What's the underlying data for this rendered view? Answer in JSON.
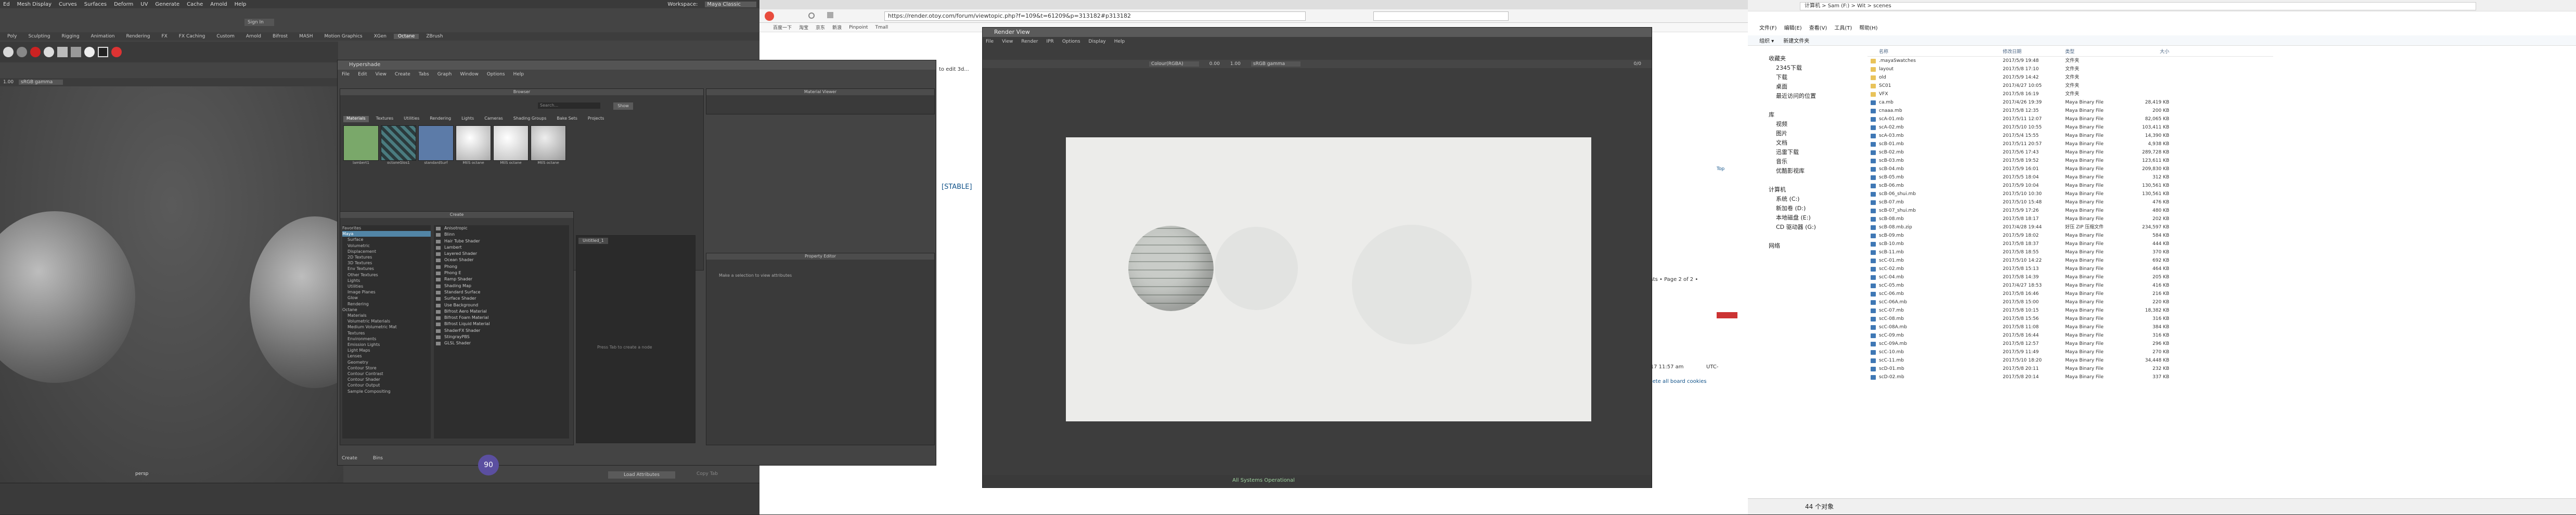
{
  "maya": {
    "menu": [
      "Ed",
      "Mesh Display",
      "Curves",
      "Surfaces",
      "Deform",
      "UV",
      "Generate",
      "Cache",
      "Arnold",
      "Help"
    ],
    "workspace_label": "Workspace:",
    "workspace_value": "Maya Classic",
    "signin": "Sign In",
    "shelf_tabs": [
      "Poly",
      "Sculpting",
      "Rigging",
      "Animation",
      "Rendering",
      "FX",
      "FX Caching",
      "Custom",
      "Arnold",
      "Bifrost",
      "MASH",
      "Motion Graphics",
      "XGen",
      "Octane",
      "ZBrush"
    ],
    "active_shelf": "Octane",
    "viewport_label": "persp",
    "gamma_value": "sRGB gamma",
    "time_value": "1.00"
  },
  "hypershade": {
    "title": "Hypershade",
    "menu": [
      "File",
      "Edit",
      "View",
      "Create",
      "Tabs",
      "Graph",
      "Window",
      "Options",
      "Help"
    ],
    "browser_label": "Browser",
    "search_placeholder": "Search...",
    "material_viewer": "Material Viewer",
    "tabs": [
      "Materials",
      "Textures",
      "Utilities",
      "Rendering",
      "Lights",
      "Cameras",
      "Shading Groups",
      "Bake Sets",
      "Projects"
    ],
    "active_tab": "Materials",
    "swatches": [
      {
        "label": "lambert1",
        "color": "#7aa86a"
      },
      {
        "label": "octaneGlos1",
        "color": "#4a7b7f"
      },
      {
        "label": "standardSurf",
        "color": "#5c7ba8"
      },
      {
        "label": "MtlS octane",
        "color": "#d8d8d8"
      },
      {
        "label": "MtlS octane",
        "color": "#e4e4e4"
      },
      {
        "label": "MtlS octane",
        "color": "#cfcfcf"
      }
    ],
    "create_label": "Create",
    "create_tree": [
      "Favorites",
      "Maya",
      "Surface",
      "Volumetric",
      "Displacement",
      "2D Textures",
      "3D Textures",
      "Env Textures",
      "Other Textures",
      "Lights",
      "Utilities",
      "Image Planes",
      "Glow",
      "Rendering",
      "Octane",
      "Materials",
      "Volumetric Materials",
      "Medium Volumetric Mat",
      "Textures",
      "Environments",
      "Emission Lights",
      "Light Maps",
      "Lenses",
      "Geometry",
      "Contour Store",
      "Contour Contrast",
      "Contour Shader",
      "Contour Output",
      "Sample Compositing"
    ],
    "selected_tree": "Maya",
    "shaders": [
      "Anisotropic",
      "Blinn",
      "Hair Tube Shader",
      "Lambert",
      "Layered Shader",
      "Ocean Shader",
      "Phong",
      "Phong E",
      "Ramp Shader",
      "Shading Map",
      "Standard Surface",
      "Surface Shader",
      "Use Background",
      "Bifrost Aero Material",
      "Bifrost Foam Material",
      "Bifrost Liquid Material",
      "ShaderFX Shader",
      "StingrayPBS",
      "GLSL Shader"
    ],
    "workspace_tab": "Untitled_1",
    "workspace_hint": "Press Tab to create a node",
    "property_editor": "Property Editor",
    "property_hint": "Make a selection to view attributes",
    "bottom_tabs": [
      "Create",
      "Bins"
    ],
    "load_attributes": "Load Attributes",
    "copy_tab": "Copy Tab",
    "progress_value": "90"
  },
  "browser": {
    "url": "https://render.otoy.com/forum/viewtopic.php?f=109&t=61209&p=313182#p313182",
    "bookmarks": [
      "百度一下",
      "淘宝",
      "京东",
      "新浪",
      "Pinpoint",
      "Tmall"
    ],
    "edit_text": "to edit 3d...",
    "stable_text": "[STABLE]",
    "posts_text": "posts • Page 2 of 2 •",
    "date_text": "2017 11:57 am",
    "tz_text": "UTC-",
    "delete_text": "Delete all board cookies",
    "systems": "All Systems Operational",
    "back_to_top": "Top"
  },
  "renderview": {
    "title": "Render View",
    "menu": [
      "File",
      "View",
      "Render",
      "IPR",
      "Options",
      "Display",
      "Help"
    ],
    "channel": "Colour(RGBA)",
    "zoom": "0.00",
    "size": "1.00",
    "gamma": "sRGB gamma",
    "frame": "0/0"
  },
  "explorer": {
    "path": "计算机 > Sam (F:) > Wit > scenes",
    "menu": [
      "文件(F)",
      "编辑(E)",
      "查看(V)",
      "工具(T)",
      "帮助(H)"
    ],
    "toolbar": [
      "组织 ▾",
      "新建文件夹"
    ],
    "nav": [
      "收藏夹",
      "2345下载",
      "下载",
      "桌面",
      "最近访问的位置",
      "",
      "库",
      "视频",
      "图片",
      "文档",
      "迅雷下载",
      "音乐",
      "优酷影视库",
      "",
      "计算机",
      "系统 (C:)",
      "新加卷 (D:)",
      "本地磁盘 (E:)",
      "CD 驱动器 (G:)",
      "",
      "网络"
    ],
    "headers": [
      "名称",
      "修改日期",
      "类型",
      "大小"
    ],
    "files": [
      {
        "name": ".mayaSwatches",
        "date": "2017/5/9 19:48",
        "type": "文件夹",
        "size": "",
        "folder": true
      },
      {
        "name": "layout",
        "date": "2017/5/8 17:10",
        "type": "文件夹",
        "size": "",
        "folder": true
      },
      {
        "name": "old",
        "date": "2017/5/9 14:42",
        "type": "文件夹",
        "size": "",
        "folder": true
      },
      {
        "name": "SC01",
        "date": "2017/4/27 10:05",
        "type": "文件夹",
        "size": "",
        "folder": true
      },
      {
        "name": "VFX",
        "date": "2017/5/8 16:19",
        "type": "文件夹",
        "size": "",
        "folder": true
      },
      {
        "name": "ca.mb",
        "date": "2017/4/26 19:39",
        "type": "Maya Binary File",
        "size": "28,419 KB"
      },
      {
        "name": "cnaaa.mb",
        "date": "2017/5/8 12:35",
        "type": "Maya Binary File",
        "size": "200 KB"
      },
      {
        "name": "scA-01.mb",
        "date": "2017/5/11 12:07",
        "type": "Maya Binary File",
        "size": "82,065 KB"
      },
      {
        "name": "scA-02.mb",
        "date": "2017/5/10 10:55",
        "type": "Maya Binary File",
        "size": "103,411 KB"
      },
      {
        "name": "scA-03.mb",
        "date": "2017/5/4 15:55",
        "type": "Maya Binary File",
        "size": "14,390 KB"
      },
      {
        "name": "scB-01.mb",
        "date": "2017/5/11 20:57",
        "type": "Maya Binary File",
        "size": "4,938 KB"
      },
      {
        "name": "scB-02.mb",
        "date": "2017/5/6 17:43",
        "type": "Maya Binary File",
        "size": "289,728 KB"
      },
      {
        "name": "scB-03.mb",
        "date": "2017/5/8 19:52",
        "type": "Maya Binary File",
        "size": "123,611 KB"
      },
      {
        "name": "scB-04.mb",
        "date": "2017/5/9 16:01",
        "type": "Maya Binary File",
        "size": "209,830 KB"
      },
      {
        "name": "scB-05.mb",
        "date": "2017/5/5 18:04",
        "type": "Maya Binary File",
        "size": "312 KB"
      },
      {
        "name": "scB-06.mb",
        "date": "2017/5/9 10:04",
        "type": "Maya Binary File",
        "size": "130,561 KB"
      },
      {
        "name": "scB-06_shui.mb",
        "date": "2017/5/10 10:30",
        "type": "Maya Binary File",
        "size": "130,561 KB"
      },
      {
        "name": "scB-07.mb",
        "date": "2017/5/10 15:48",
        "type": "Maya Binary File",
        "size": "476 KB"
      },
      {
        "name": "scB-07_shui.mb",
        "date": "2017/5/9 17:26",
        "type": "Maya Binary File",
        "size": "480 KB"
      },
      {
        "name": "scB-08.mb",
        "date": "2017/5/8 18:17",
        "type": "Maya Binary File",
        "size": "202 KB"
      },
      {
        "name": "scB-08.mb.zip",
        "date": "2017/4/28 19:44",
        "type": "好压 ZIP 压缩文件",
        "size": "234,597 KB"
      },
      {
        "name": "scB-09.mb",
        "date": "2017/5/9 18:02",
        "type": "Maya Binary File",
        "size": "584 KB"
      },
      {
        "name": "scB-10.mb",
        "date": "2017/5/8 18:37",
        "type": "Maya Binary File",
        "size": "444 KB"
      },
      {
        "name": "scB-11.mb",
        "date": "2017/5/8 18:55",
        "type": "Maya Binary File",
        "size": "370 KB"
      },
      {
        "name": "scC-01.mb",
        "date": "2017/5/10 14:22",
        "type": "Maya Binary File",
        "size": "692 KB"
      },
      {
        "name": "scC-02.mb",
        "date": "2017/5/8 15:13",
        "type": "Maya Binary File",
        "size": "464 KB"
      },
      {
        "name": "scC-04.mb",
        "date": "2017/5/8 14:39",
        "type": "Maya Binary File",
        "size": "205 KB"
      },
      {
        "name": "scC-05.mb",
        "date": "2017/4/27 18:53",
        "type": "Maya Binary File",
        "size": "416 KB"
      },
      {
        "name": "scC-06.mb",
        "date": "2017/5/8 16:46",
        "type": "Maya Binary File",
        "size": "216 KB"
      },
      {
        "name": "scC-06A.mb",
        "date": "2017/5/8 15:00",
        "type": "Maya Binary File",
        "size": "220 KB"
      },
      {
        "name": "scC-07.mb",
        "date": "2017/5/8 10:15",
        "type": "Maya Binary File",
        "size": "18,382 KB"
      },
      {
        "name": "scC-08.mb",
        "date": "2017/5/8 15:56",
        "type": "Maya Binary File",
        "size": "316 KB"
      },
      {
        "name": "scC-08A.mb",
        "date": "2017/5/8 11:08",
        "type": "Maya Binary File",
        "size": "384 KB"
      },
      {
        "name": "scC-09.mb",
        "date": "2017/5/8 16:44",
        "type": "Maya Binary File",
        "size": "316 KB"
      },
      {
        "name": "scC-09A.mb",
        "date": "2017/5/8 12:57",
        "type": "Maya Binary File",
        "size": "296 KB"
      },
      {
        "name": "scC-10.mb",
        "date": "2017/5/9 11:49",
        "type": "Maya Binary File",
        "size": "270 KB"
      },
      {
        "name": "scC-11.mb",
        "date": "2017/5/10 18:20",
        "type": "Maya Binary File",
        "size": "34,448 KB"
      },
      {
        "name": "scD-01.mb",
        "date": "2017/5/8 20:11",
        "type": "Maya Binary File",
        "size": "232 KB"
      },
      {
        "name": "scD-02.mb",
        "date": "2017/5/8 20:14",
        "type": "Maya Binary File",
        "size": "337 KB"
      }
    ],
    "status": "44 个对象"
  },
  "colors": {
    "maya_bg": "#444444",
    "accent_blue": "#5285a6",
    "explorer_folder": "#e9c35a",
    "maya_file": "#3f78b5"
  }
}
